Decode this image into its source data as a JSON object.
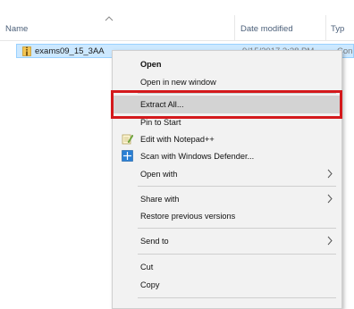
{
  "columns": {
    "name": "Name",
    "date_modified": "Date modified",
    "type": "Typ"
  },
  "file": {
    "name": "exams09_15_3AA",
    "date": "9/15/2017 3:38 PM",
    "type": "Con"
  },
  "menu": {
    "open": "Open",
    "open_new_window": "Open in new window",
    "extract_all": "Extract All...",
    "pin_to_start": "Pin to Start",
    "edit_notepad": "Edit with Notepad++",
    "scan_defender": "Scan with Windows Defender...",
    "open_with": "Open with",
    "share_with": "Share with",
    "restore_versions": "Restore previous versions",
    "send_to": "Send to",
    "cut": "Cut",
    "copy": "Copy"
  },
  "colors": {
    "selection": "#cce8ff",
    "highlight_box": "#d4191c",
    "menu_bg": "#f2f2f2"
  },
  "icons": {
    "file": "zip-folder-icon",
    "notepad": "notepad-plus-plus-icon",
    "defender": "windows-defender-icon",
    "submenu": "chevron-right-icon",
    "sort": "sort-up-icon"
  }
}
